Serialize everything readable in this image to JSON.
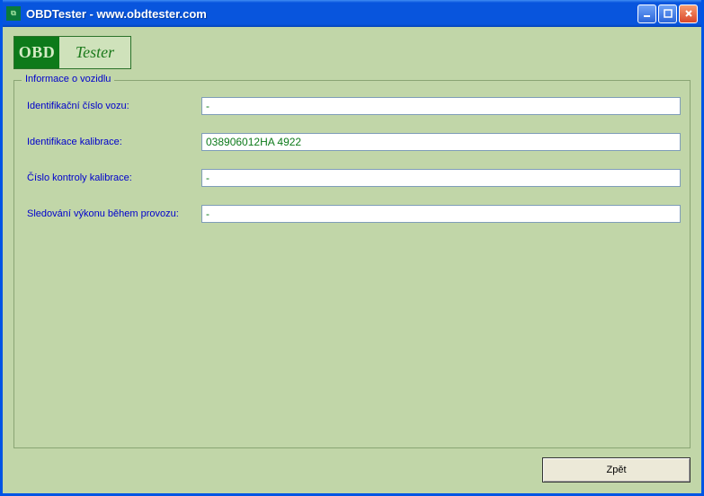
{
  "titlebar": {
    "title": "OBDTester - www.obdtester.com"
  },
  "logo": {
    "left": "OBD",
    "right": "Tester"
  },
  "groupbox": {
    "legend": "Informace o vozidlu",
    "fields": [
      {
        "label": "Identifikační číslo vozu:",
        "value": "-"
      },
      {
        "label": "Identifikace kalibrace:",
        "value": "038906012HA 4922"
      },
      {
        "label": "Číslo kontroly kalibrace:",
        "value": "-"
      },
      {
        "label": "Sledování výkonu během provozu:",
        "value": "-"
      }
    ]
  },
  "buttons": {
    "back": "Zpět"
  }
}
